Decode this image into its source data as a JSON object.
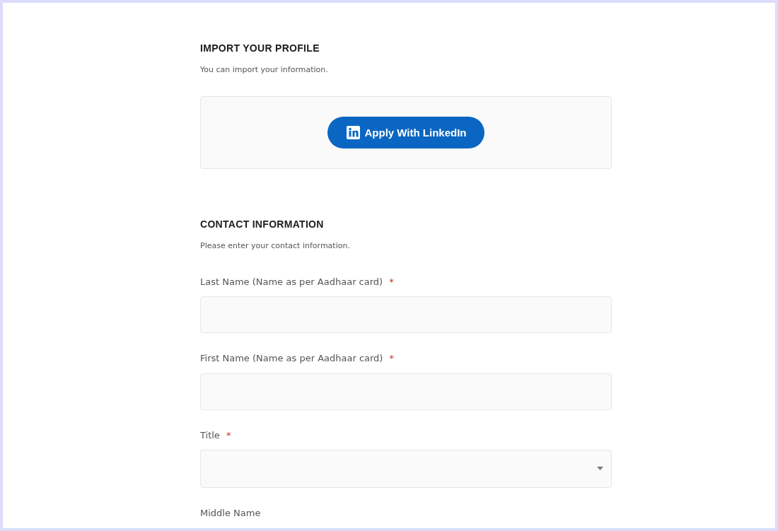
{
  "sections": [
    {
      "kind": "import",
      "heading": "IMPORT YOUR PROFILE",
      "description": "You can import your information.",
      "button": {
        "label": "Apply With LinkedIn"
      }
    },
    {
      "kind": "form",
      "heading": "CONTACT INFORMATION",
      "description": "Please enter your contact information.",
      "fields": [
        {
          "kind": "text",
          "label": "Last Name (Name as per Aadhaar card)",
          "required_mark": "*"
        },
        {
          "kind": "text",
          "label": "First Name (Name as per Aadhaar card)",
          "required_mark": "*"
        },
        {
          "kind": "select",
          "label": "Title",
          "required_mark": "*"
        },
        {
          "kind": "text",
          "label": "Middle Name"
        }
      ]
    }
  ]
}
